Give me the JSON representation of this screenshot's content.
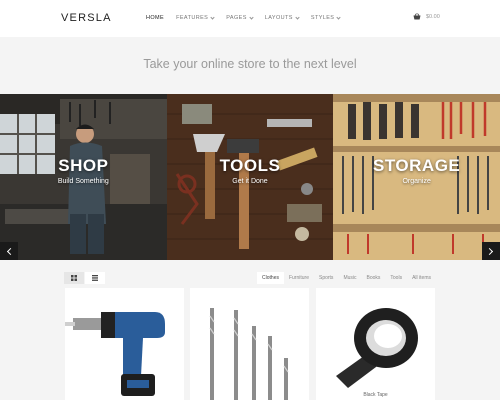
{
  "header": {
    "logo": "VERSLA",
    "nav": [
      {
        "label": "HOME",
        "active": true,
        "dropdown": false
      },
      {
        "label": "FEATURES",
        "active": false,
        "dropdown": true
      },
      {
        "label": "PAGES",
        "active": false,
        "dropdown": true
      },
      {
        "label": "LAYOUTS",
        "active": false,
        "dropdown": true
      },
      {
        "label": "STYLES",
        "active": false,
        "dropdown": true
      }
    ],
    "cart_total": "$0.00"
  },
  "tagline": "Take your online store to the next level",
  "banner": {
    "panels": [
      {
        "title": "SHOP",
        "subtitle": "Build Something"
      },
      {
        "title": "TOOLS",
        "subtitle": "Get it Done"
      },
      {
        "title": "STORAGE",
        "subtitle": "Organize"
      }
    ]
  },
  "filters": [
    "Clothes",
    "Furniture",
    "Sports",
    "Music",
    "Books",
    "Tools",
    "All items"
  ],
  "active_filter": "Clothes",
  "products": [
    {
      "name": "",
      "icon": "cordless-drill"
    },
    {
      "name": "",
      "icon": "drill-bits"
    },
    {
      "name": "Black Tape",
      "icon": "tape-roll"
    }
  ],
  "colors": {
    "accent": "#1a1a1a",
    "background": "#f4f4f4"
  }
}
